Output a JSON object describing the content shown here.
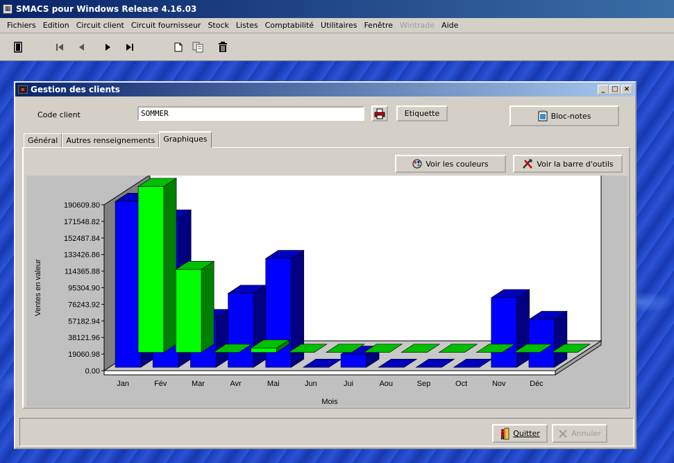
{
  "app": {
    "title": "SMACS pour Windows Release 4.16.03",
    "icon": "calculator-icon"
  },
  "menu": [
    {
      "label": "Fichiers",
      "enabled": true
    },
    {
      "label": "Edition",
      "enabled": true
    },
    {
      "label": "Circuit client",
      "enabled": true
    },
    {
      "label": "Circuit fournisseur",
      "enabled": true
    },
    {
      "label": "Stock",
      "enabled": true
    },
    {
      "label": "Listes",
      "enabled": true
    },
    {
      "label": "Comptabilité",
      "enabled": true
    },
    {
      "label": "Utilitaires",
      "enabled": true
    },
    {
      "label": "Fenêtre",
      "enabled": true
    },
    {
      "label": "Wintrade",
      "enabled": false
    },
    {
      "label": "Aide",
      "enabled": true
    }
  ],
  "toolbar": {
    "icons": [
      "exit-door-icon",
      "first-record-icon",
      "previous-record-icon",
      "next-record-icon",
      "last-record-icon",
      "new-document-icon",
      "copy-icon",
      "delete-trash-icon"
    ]
  },
  "window": {
    "title": "Gestion des clients",
    "code_label": "Code client",
    "code_value": "SOMMER",
    "etiquette_label": "Etiquette",
    "blocnotes_label": "Bloc-notes",
    "tabs": [
      "Général",
      "Autres renseignements",
      "Graphiques"
    ],
    "active_tab": 2,
    "voir_couleurs_label": "Voir les couleurs",
    "voir_barre_label": "Voir la barre d'outils",
    "quitter_label": "Quitter",
    "annuler_label": "Annuler"
  },
  "colors": {
    "series_blue": "#0000ff",
    "series_green": "#00ff00",
    "accent": "#0a246a"
  },
  "chart_data": {
    "type": "bar",
    "subtype": "3d-grouped",
    "title": "",
    "xlabel": "Mois",
    "ylabel": "Ventes en valeur",
    "categories": [
      "Jan",
      "Fév",
      "Mar",
      "Avr",
      "Mai",
      "Jun",
      "Jui",
      "Aou",
      "Sep",
      "Oct",
      "Nov",
      "Déc"
    ],
    "yticks": [
      "0.00",
      "19060.98",
      "38121.96",
      "57182.94",
      "76243.92",
      "95304.90",
      "114365.88",
      "133426.86",
      "152487.84",
      "171548.82",
      "190609.80"
    ],
    "ylim": [
      0,
      190609.8
    ],
    "grid": false,
    "legend": "none",
    "series": [
      {
        "color": "#00ff00",
        "values": [
          190609.8,
          95304.9,
          0,
          5000,
          0,
          0,
          0,
          0,
          0,
          0,
          0,
          0
        ]
      },
      {
        "color": "#0000ff",
        "values": [
          190609.8,
          171548.82,
          57182.94,
          85000,
          125000,
          0,
          15000,
          0,
          0,
          0,
          80000,
          55000
        ]
      }
    ]
  }
}
